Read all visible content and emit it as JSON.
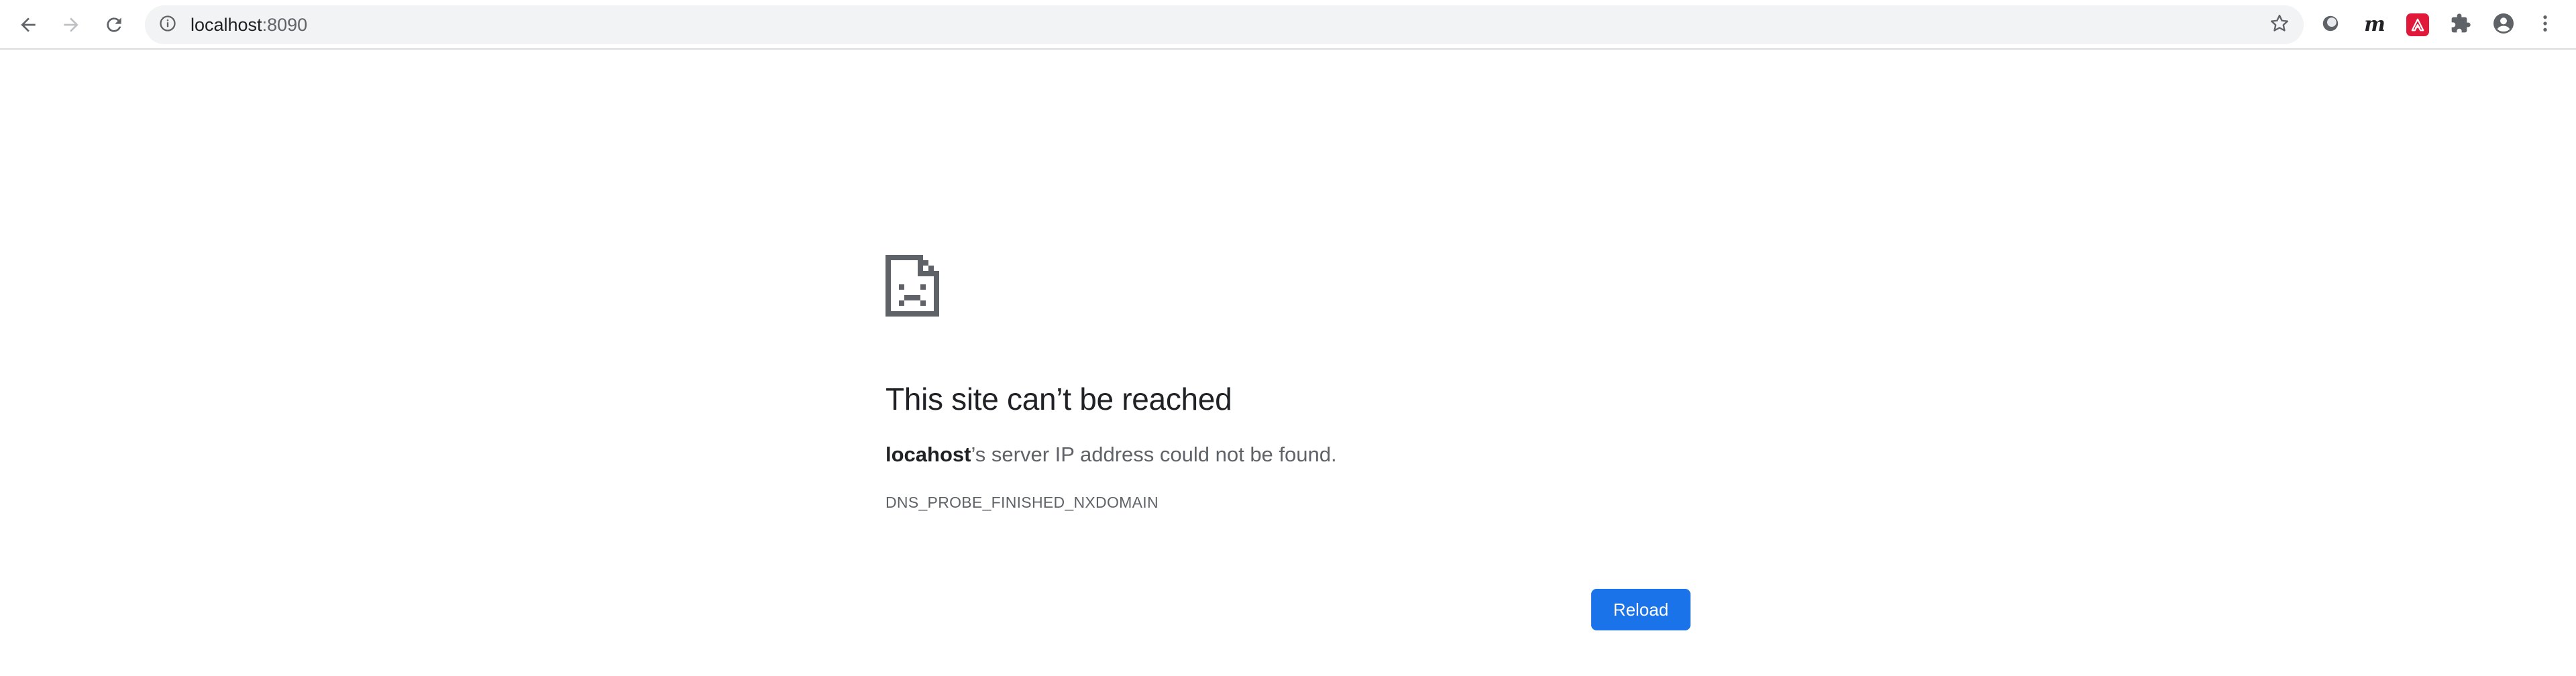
{
  "browser": {
    "url_host": "localhost",
    "url_port": ":8090",
    "accent": "#1a73e8"
  },
  "toolbar_icons": [
    "back-icon",
    "forward-icon",
    "reload-icon",
    "info-icon",
    "star-icon",
    "circle-extension-icon",
    "m-extension-icon",
    "red-extension-icon",
    "puzzle-icon",
    "profile-icon",
    "more-vert-icon"
  ],
  "extensions": {
    "m_label": "m"
  },
  "error": {
    "headline": "This site can’t be reached",
    "summary_host": "locahost",
    "summary_rest": "’s server IP address could not be found.",
    "code": "DNS_PROBE_FINISHED_NXDOMAIN",
    "reload_label": "Reload"
  }
}
